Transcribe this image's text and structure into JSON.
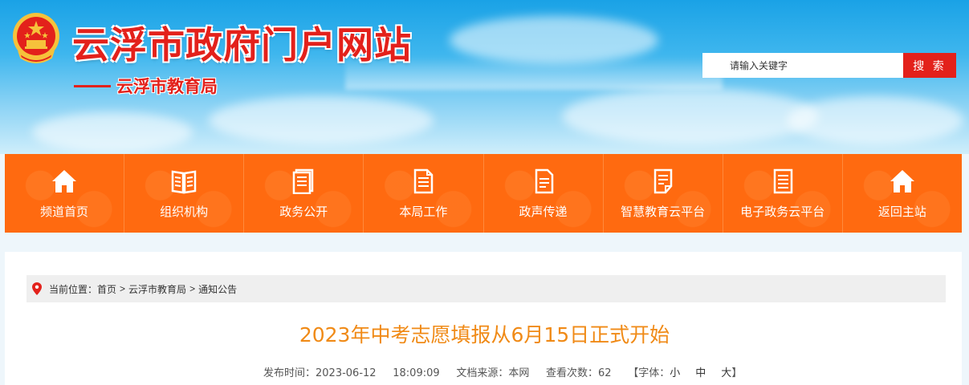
{
  "header": {
    "site_title": "云浮市政府门户网站",
    "sub_title": "云浮市教育局",
    "search_placeholder": "请输入关键字",
    "search_button": "搜 索",
    "colors": {
      "brand_red": "#e3211b",
      "sky_blue": "#1aa2e6"
    },
    "emblem_icon": "national-emblem-icon"
  },
  "nav": {
    "color": "#ff6d14",
    "items": [
      {
        "label": "频道首页",
        "icon": "home-icon"
      },
      {
        "label": "组织机构",
        "icon": "book-icon"
      },
      {
        "label": "政务公开",
        "icon": "document-icon"
      },
      {
        "label": "本局工作",
        "icon": "document-lines-icon"
      },
      {
        "label": "政声传递",
        "icon": "notes-icon"
      },
      {
        "label": "智慧教育云平台",
        "icon": "checklist-icon"
      },
      {
        "label": "电子政务云平台",
        "icon": "list-doc-icon"
      },
      {
        "label": "返回主站",
        "icon": "home-icon"
      }
    ]
  },
  "breadcrumb": {
    "prefix": "当前位置：",
    "items": [
      "首页",
      "云浮市教育局",
      "通知公告"
    ],
    "separator": ">"
  },
  "article": {
    "title": "2023年中考志愿填报从6月15日正式开始",
    "title_color": "#f08a16",
    "publish_label": "发布时间：",
    "publish_date": "2023-06-12",
    "publish_time": "18:09:09",
    "source_label": "文档来源：",
    "source": "本网",
    "views_label": "查看次数：",
    "views": "62",
    "font_label": "【字体：",
    "font_options": [
      "小",
      "中",
      "大"
    ],
    "font_close": "】"
  }
}
